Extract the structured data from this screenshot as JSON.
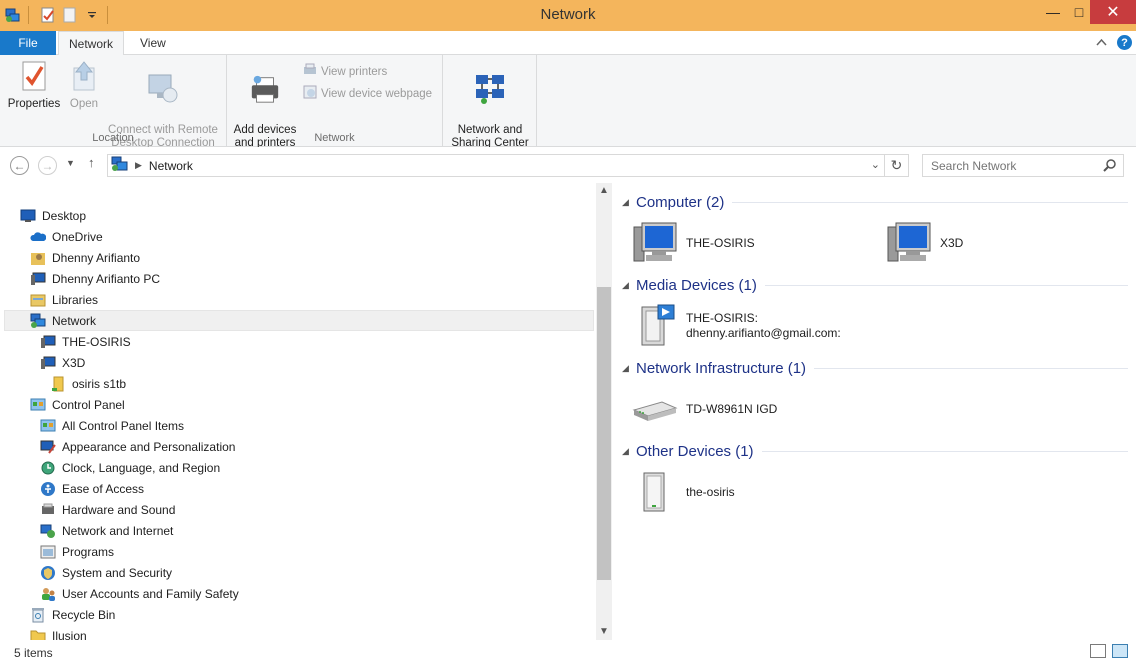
{
  "window": {
    "title": "Network",
    "minimize": "—",
    "maximize": "□",
    "close": "✕"
  },
  "ribbon": {
    "tabs": [
      "File",
      "Network",
      "View"
    ],
    "groups": {
      "location": {
        "label": "Location",
        "buttons": [
          {
            "label": "Properties",
            "enabled": true,
            "icon": "properties-icon"
          },
          {
            "label": "Open",
            "enabled": false,
            "icon": "open-icon"
          },
          {
            "label": "Connect with Remote\nDesktop Connection",
            "enabled": false,
            "icon": "remote-desktop-icon"
          }
        ]
      },
      "network": {
        "label": "Network",
        "add_devices": "Add devices\nand printers",
        "view_printers": "View printers",
        "view_device_webpage": "View device webpage"
      },
      "sharing": {
        "label": "Network and\nSharing Center"
      }
    }
  },
  "address_bar": {
    "location": "Network",
    "search_placeholder": "Search Network"
  },
  "nav_tree": [
    {
      "label": "Desktop",
      "icon": "desktop-icon",
      "level": 0
    },
    {
      "label": "OneDrive",
      "icon": "onedrive-icon",
      "level": 1
    },
    {
      "label": "Dhenny Arifianto",
      "icon": "user-folder-icon",
      "level": 1
    },
    {
      "label": "Dhenny Arifianto PC",
      "icon": "pc-icon",
      "level": 1
    },
    {
      "label": "Libraries",
      "icon": "libraries-icon",
      "level": 1
    },
    {
      "label": "Network",
      "icon": "network-icon",
      "level": 1,
      "selected": true
    },
    {
      "label": "THE-OSIRIS",
      "icon": "computer-icon",
      "level": 2
    },
    {
      "label": "X3D",
      "icon": "computer-icon",
      "level": 2
    },
    {
      "label": "osiris s1tb",
      "icon": "shared-folder-icon",
      "level": 3
    },
    {
      "label": "Control Panel",
      "icon": "control-panel-icon",
      "level": 1
    },
    {
      "label": "All Control Panel Items",
      "icon": "control-panel-icon",
      "level": 2
    },
    {
      "label": "Appearance and Personalization",
      "icon": "appearance-icon",
      "level": 2
    },
    {
      "label": "Clock, Language, and Region",
      "icon": "clock-icon",
      "level": 2
    },
    {
      "label": "Ease of Access",
      "icon": "ease-of-access-icon",
      "level": 2
    },
    {
      "label": "Hardware and Sound",
      "icon": "hardware-icon",
      "level": 2
    },
    {
      "label": "Network and Internet",
      "icon": "network-internet-icon",
      "level": 2
    },
    {
      "label": "Programs",
      "icon": "programs-icon",
      "level": 2
    },
    {
      "label": "System and Security",
      "icon": "security-icon",
      "level": 2
    },
    {
      "label": "User Accounts and Family Safety",
      "icon": "user-accounts-icon",
      "level": 2
    },
    {
      "label": "Recycle Bin",
      "icon": "recycle-bin-icon",
      "level": 1
    },
    {
      "label": "Ilusion",
      "icon": "folder-icon",
      "level": 1
    }
  ],
  "content": {
    "groups": [
      {
        "title": "Computer (2)",
        "items": [
          "THE-OSIRIS",
          "X3D"
        ]
      },
      {
        "title": "Media Devices (1)",
        "items": [
          "THE-OSIRIS:\ndhenny.arifianto@gmail.com:"
        ]
      },
      {
        "title": "Network Infrastructure (1)",
        "items": [
          "TD-W8961N IGD"
        ]
      },
      {
        "title": "Other Devices (1)",
        "items": [
          "the-osiris"
        ]
      }
    ]
  },
  "status_bar": {
    "item_count": "5 items"
  },
  "colors": {
    "titlebar": "#f4b55c",
    "file_tab": "#1979ca",
    "group_heading": "#1e3287",
    "close_button": "#c73c3e"
  }
}
